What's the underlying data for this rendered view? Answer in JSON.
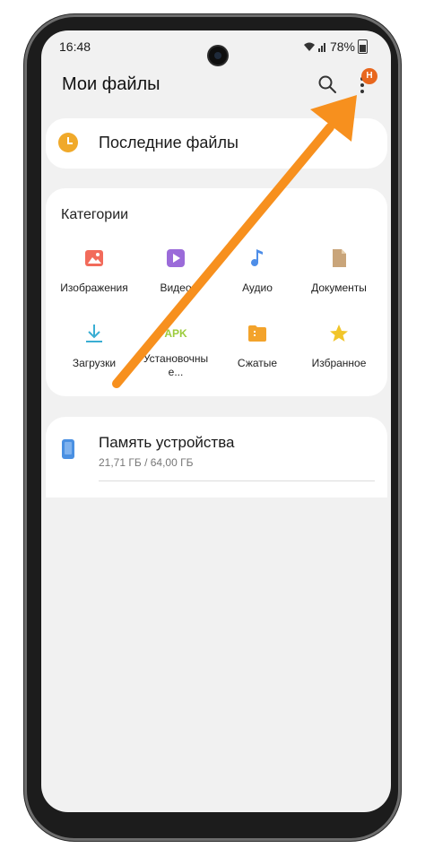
{
  "status": {
    "time": "16:48",
    "battery": "78%"
  },
  "appbar": {
    "title": "Мои файлы",
    "badge": "Н"
  },
  "recent": {
    "label": "Последние файлы"
  },
  "categories": {
    "title": "Категории",
    "items": [
      {
        "label": "Изображения",
        "icon": "image-icon",
        "color": "#f26b5b"
      },
      {
        "label": "Видео",
        "icon": "video-icon",
        "color": "#9b6bd9"
      },
      {
        "label": "Аудио",
        "icon": "music-note-icon",
        "color": "#4e8ee8"
      },
      {
        "label": "Документы",
        "icon": "document-icon",
        "color": "#c9a57a"
      },
      {
        "label": "Загрузки",
        "icon": "download-icon",
        "color": "#3aaed3"
      },
      {
        "label": "Установочные файлы",
        "label_display": "Установочны\nе...",
        "icon": "apk-icon",
        "color": "#9ccc3c",
        "icon_text": "APK"
      },
      {
        "label": "Сжатые",
        "icon": "archive-icon",
        "color": "#f3a32b"
      },
      {
        "label": "Избранное",
        "icon": "star-icon",
        "color": "#f1c52a"
      }
    ]
  },
  "storage": {
    "title": "Память устройства",
    "usage": "21,71 ГБ / 64,00 ГБ"
  },
  "accent_arrow_color": "#f7901e"
}
